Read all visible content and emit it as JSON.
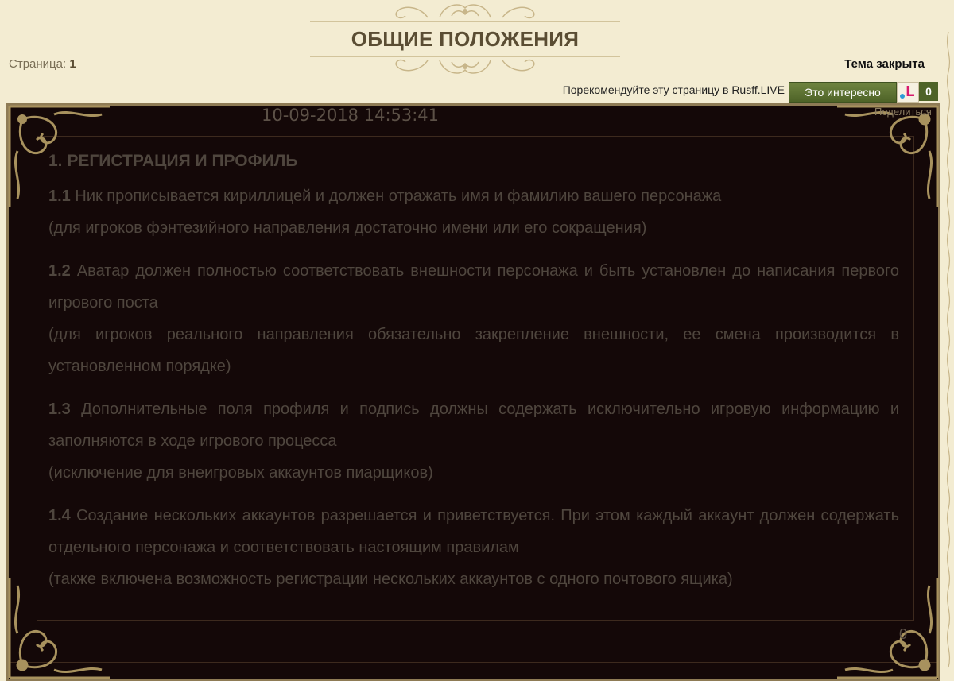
{
  "page": {
    "title": "ОБЩИЕ ПОЛОЖЕНИЯ",
    "pages_label": "Страница:",
    "pages_value": "1",
    "status": "Тема закрыта"
  },
  "share_bar": {
    "recommend_text": "Порекомендуйте эту страницу в Rusff.LIVE",
    "like_button": "Это интересно",
    "logo_letter": "L",
    "count": "0",
    "share_link": "Поделиться"
  },
  "post": {
    "date": "10-09-2018 14:53:41",
    "heading": "1. РЕГИСТРАЦИЯ И ПРОФИЛЬ",
    "items": [
      {
        "num": "1.1",
        "text": "Ник прописывается кириллицей и должен отражать имя и фамилию вашего персонажа",
        "note": "(для игроков фэнтезийного направления достаточно имени или его сокращения)"
      },
      {
        "num": "1.2",
        "text": "Аватар должен полностью соответствовать внешности персонажа и быть установлен до написания первого игрового поста",
        "note": "(для игроков реального направления обязательно закрепление внешности, ее смена производится в установленном порядке)"
      },
      {
        "num": "1.3",
        "text": "Дополнительные поля профиля и подпись должны содержать исключительно игровую информацию и заполняются в ходе игрового процесса",
        "note": "(исключение для внеигровых аккаунтов пиарщиков)"
      },
      {
        "num": "1.4",
        "text": "Создание нескольких аккаунтов разрешается и приветствуется. При этом каждый аккаунт должен содержать отдельного персонажа и соответствовать настоящим правилам",
        "note": "(также включена возможность регистрации нескольких аккаунтов с одного почтового ящика)"
      }
    ],
    "post_counter": "0"
  },
  "colors": {
    "page_bg": "#f3ecd2",
    "post_bg": "#140808",
    "ornament_gold": "#a8925e",
    "like_button_green": "#5b7030"
  },
  "icons": [
    "ornate-scroll-ornament",
    "ornate-corner-icon",
    "rusff-logo-icon"
  ]
}
